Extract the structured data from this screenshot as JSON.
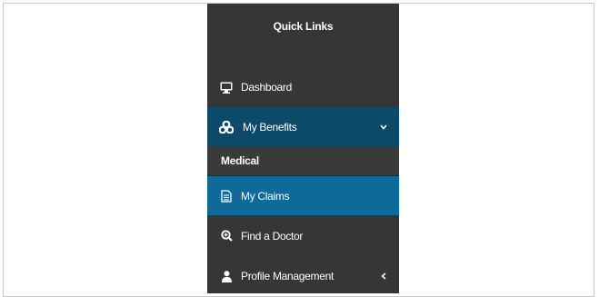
{
  "sidebar": {
    "title": "Quick Links",
    "items": [
      {
        "label": "Dashboard",
        "icon": "monitor-icon"
      },
      {
        "label": "My Benefits",
        "icon": "benefits-icon",
        "expanded": true
      },
      {
        "label": "Medical"
      },
      {
        "label": "My Claims",
        "icon": "document-icon",
        "selected": true
      },
      {
        "label": "Find a Doctor",
        "icon": "search-icon"
      },
      {
        "label": "Profile Management",
        "icon": "user-icon",
        "expanded": false
      }
    ]
  },
  "colors": {
    "sidebar_bg": "#363636",
    "expanded_bg": "#0c4a6a",
    "selected_bg": "#0f6a9c",
    "submenu_bg": "#3a3a3a",
    "text": "#ffffff"
  }
}
